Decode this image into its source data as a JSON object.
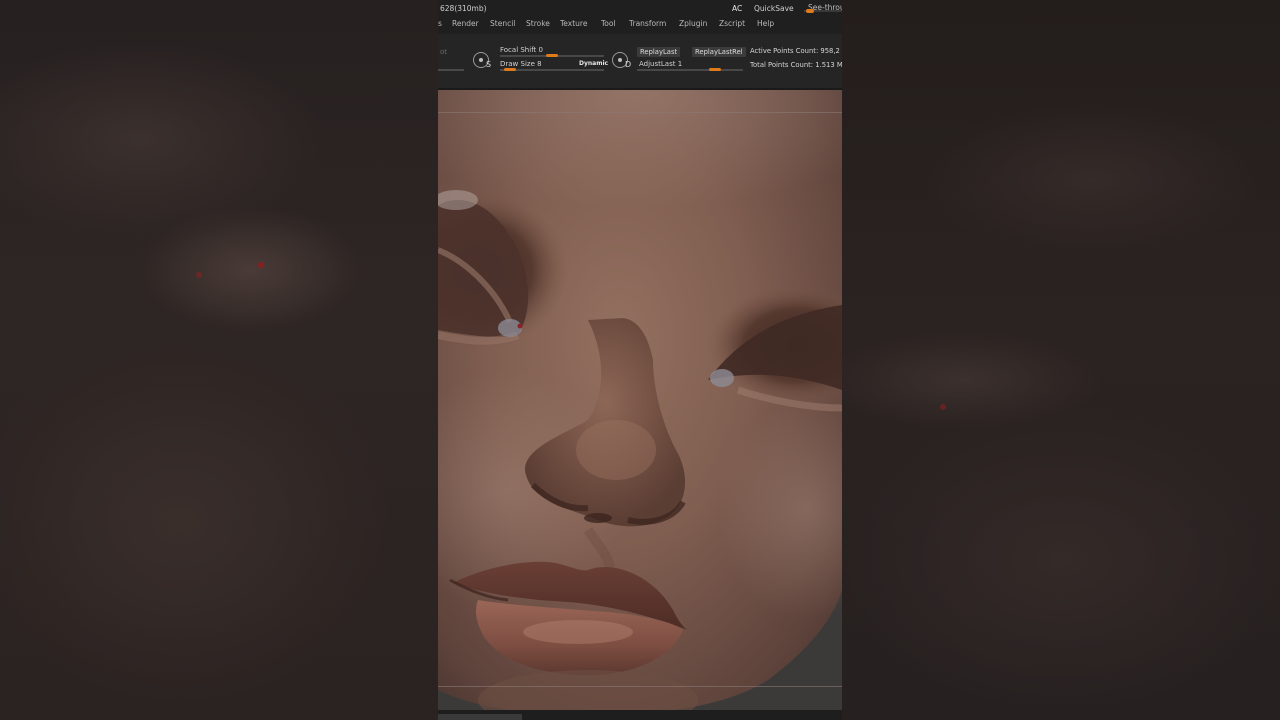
{
  "menubar": {
    "memory": "628(310mb)",
    "ac": "AC",
    "quicksave": "QuickSave",
    "see_through": "See-throu",
    "menus": [
      "s",
      "Render",
      "Stencil",
      "Stroke",
      "Texture",
      "Tool",
      "Transform",
      "Zplugin",
      "Zscript",
      "Help"
    ]
  },
  "toolbar": {
    "ghost_label": "ot",
    "focal_shift": "Focal Shift 0",
    "draw_size": "Draw Size 8",
    "dynamic": "Dynamic",
    "key_s": "S",
    "key_d": "D",
    "replay_last": "ReplayLast",
    "replay_last_rel": "ReplayLastRel",
    "adjust_last": "AdjustLast 1",
    "active_points": "Active Points Count: 958,2",
    "total_points": "Total Points Count: 1.513 M"
  },
  "colors": {
    "accent": "#e07a1a",
    "menubar_bg": "#1f1f1f",
    "toolbar_bg": "#252525",
    "skin_base": "#7d5a4e"
  },
  "icons": [
    "sculpt-brush-icon",
    "draw-brush-icon"
  ],
  "viewport": {
    "subject": "3D sculpted face close-up"
  }
}
